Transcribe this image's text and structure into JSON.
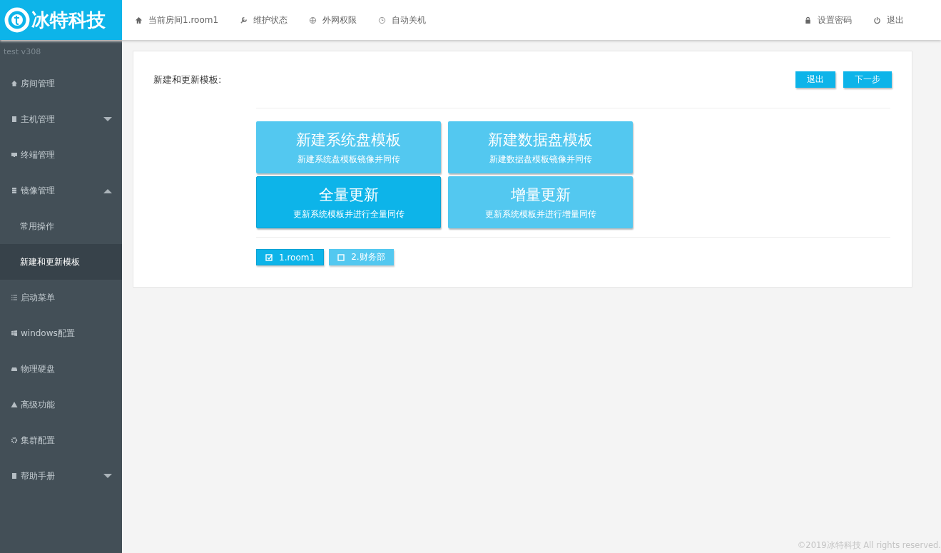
{
  "logo": {
    "text": "冰特科技"
  },
  "topnav": [
    {
      "label": "当前房间1.room1"
    },
    {
      "label": "维护状态"
    },
    {
      "label": "外网权限"
    },
    {
      "label": "自动关机"
    }
  ],
  "topnav_right": [
    {
      "label": "设置密码"
    },
    {
      "label": "退出"
    }
  ],
  "sidebar": {
    "version": "test  v308",
    "items": [
      {
        "label": "房间管理",
        "selected": false
      },
      {
        "label": "主机管理",
        "selected": false,
        "expanded": false
      },
      {
        "label": "终端管理",
        "selected": false
      },
      {
        "label": "镜像管理",
        "selected": false,
        "expanded": true,
        "children": [
          {
            "label": "常用操作",
            "selected": false
          },
          {
            "label": "新建和更新模板",
            "selected": true
          }
        ]
      },
      {
        "label": "启动菜单",
        "selected": false
      },
      {
        "label": "windows配置",
        "selected": false
      },
      {
        "label": "物理硬盘",
        "selected": false
      },
      {
        "label": "高级功能",
        "selected": false
      },
      {
        "label": "集群配置",
        "selected": false
      },
      {
        "label": "帮助手册",
        "selected": false,
        "expanded": false
      }
    ]
  },
  "panel": {
    "title": "新建和更新模板:",
    "buttons": [
      "退出",
      "下一步"
    ],
    "options": [
      {
        "title": "新建系统盘模板",
        "subtitle": "新建系统盘模板镜像并同传",
        "selected": false
      },
      {
        "title": "新建数据盘模板",
        "subtitle": "新建数据盘模板镜像并同传",
        "selected": false
      },
      {
        "title": "全量更新",
        "subtitle": "更新系统模板并进行全量同传",
        "selected": true
      },
      {
        "title": "增量更新",
        "subtitle": "更新系统模板并进行增量同传",
        "selected": false
      }
    ],
    "rooms": [
      {
        "label": "1.room1",
        "checked": true
      },
      {
        "label": "2.财务部",
        "checked": false
      }
    ]
  },
  "footer": "©2019冰特科技 All rights reserved."
}
